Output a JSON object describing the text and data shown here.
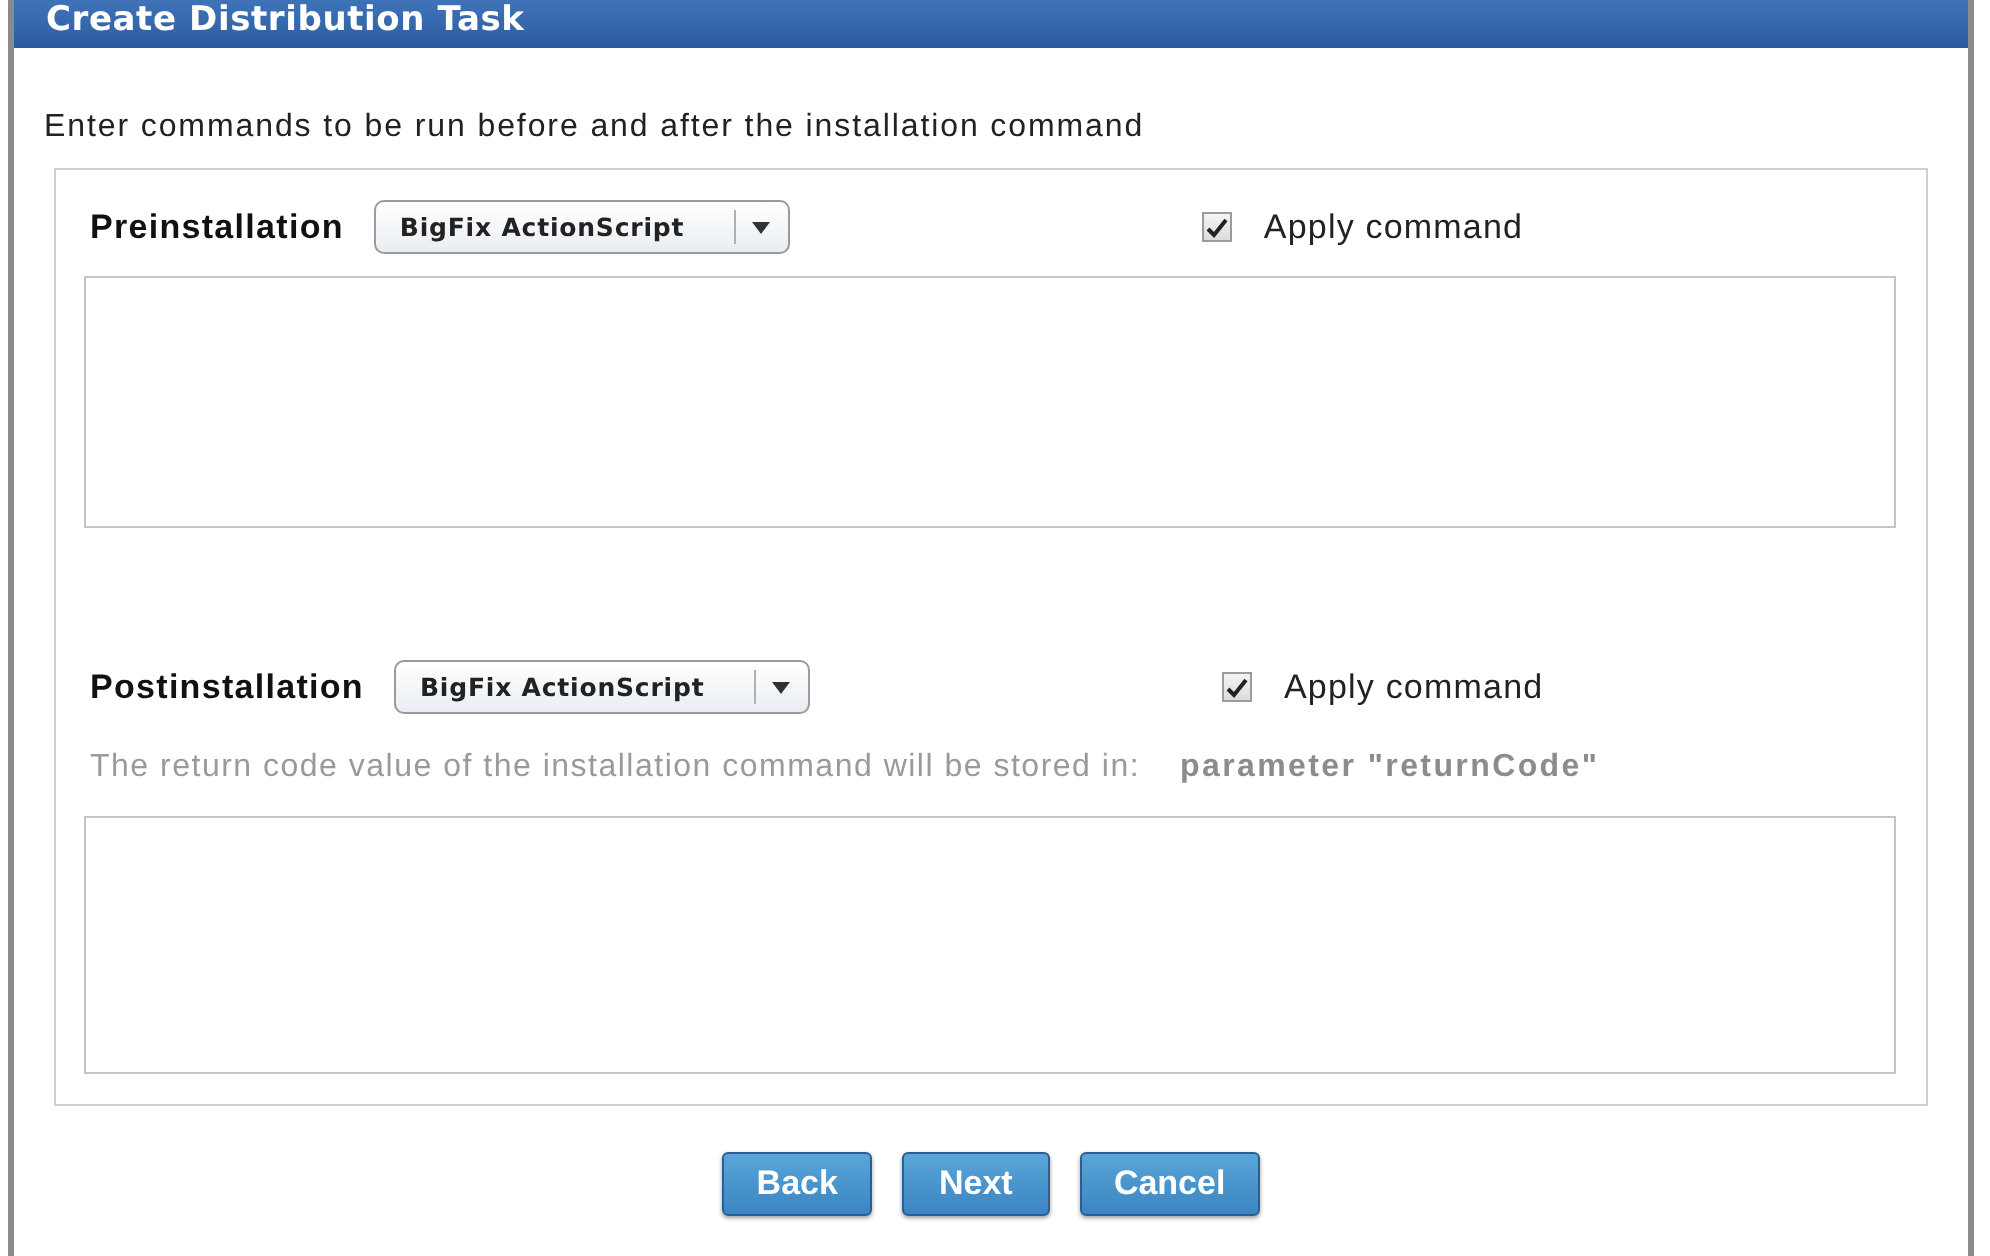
{
  "window": {
    "title": "Create Distribution Task"
  },
  "intro": "Enter commands to be run before and after the installation command",
  "sections": [
    {
      "label": "Preinstallation",
      "script_type": "BigFix ActionScript",
      "apply_command": {
        "label": "Apply command",
        "checked": true
      }
    },
    {
      "label": "Postinstallation",
      "script_type": "BigFix ActionScript",
      "apply_command": {
        "label": "Apply command",
        "checked": true
      },
      "note": "The return code value of the installation command will be stored in:",
      "note_value": "parameter \"returnCode\""
    }
  ],
  "buttons": [
    "Back",
    "Next",
    "Cancel"
  ]
}
